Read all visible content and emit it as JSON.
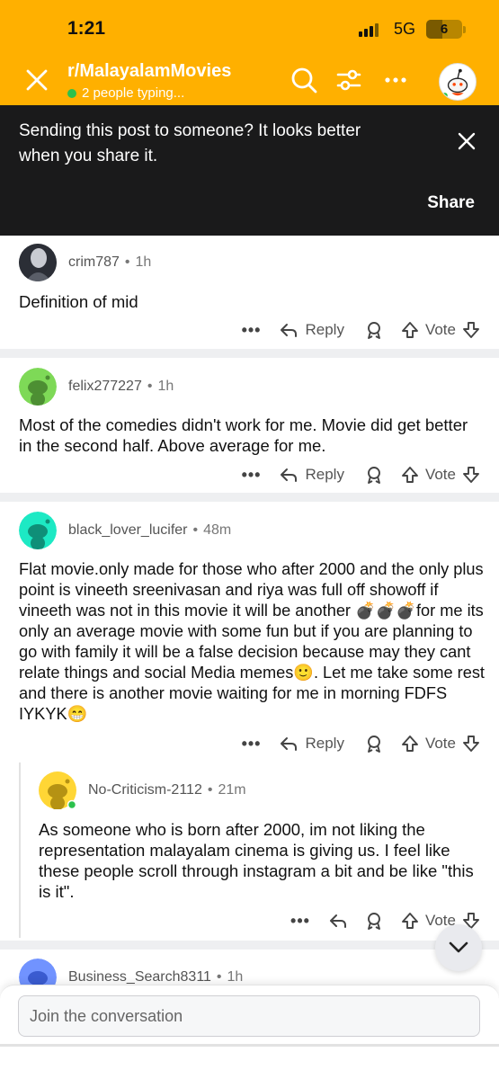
{
  "status": {
    "time": "1:21",
    "network": "5G",
    "battery": "6"
  },
  "header": {
    "title": "r/MalayalamMovies",
    "typing": "2 people typing..."
  },
  "banner": {
    "text": "Sending this post to someone? It looks better when you share it.",
    "share_label": "Share"
  },
  "comments": [
    {
      "user": "crim787",
      "time": "1h",
      "body": "Definition of mid",
      "reply_label": "Reply",
      "vote_label": "Vote"
    },
    {
      "user": "felix277227",
      "time": "1h",
      "body": "Most of the comedies didn't work for me. Movie did get better in the second half. Above average for me.",
      "reply_label": "Reply",
      "vote_label": "Vote"
    },
    {
      "user": "black_lover_lucifer",
      "time": "48m",
      "body": "Flat movie.only made for those who after 2000 and the only plus point is vineeth sreenivasan and riya was full off showoff if vineeth was not in this movie it will be another 💣💣💣for me its only an average movie with some fun but if you are planning to go with family it will be a false decision because may they cant relate things and social Media memes🙂. Let me take some rest and there is another movie waiting for me in morning FDFS IYKYK😁",
      "reply_label": "Reply",
      "vote_label": "Vote"
    },
    {
      "user": "No-Criticism-2112",
      "time": "21m",
      "body": "As someone who is born after 2000, im not liking the representation malayalam cinema is giving us. I feel like these people scroll through instagram a bit and be like \"this is it\".",
      "vote_label": "Vote"
    },
    {
      "user": "Business_Search8311",
      "time": "1h"
    }
  ],
  "composer": {
    "placeholder": "Join the conversation"
  },
  "colors": {
    "header": "#FFB000",
    "banner": "#1a1a1b",
    "online": "#2cc14c"
  },
  "icons": [
    "close-icon",
    "search-icon",
    "filter-icon",
    "more-icon",
    "avatar",
    "reply-icon",
    "award-icon",
    "upvote-icon",
    "downvote-icon",
    "chevron-down-icon"
  ]
}
